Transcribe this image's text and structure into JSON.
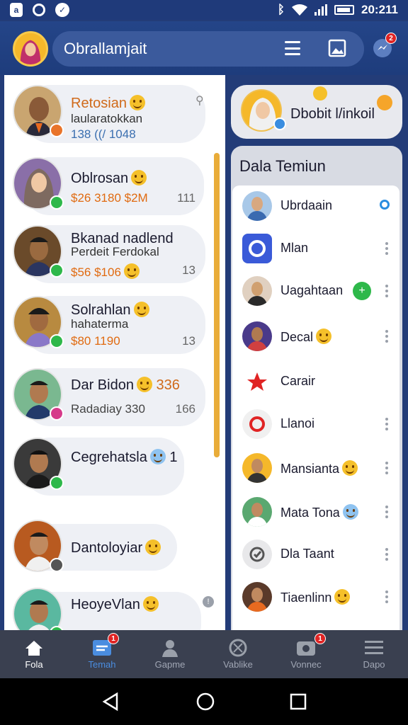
{
  "status_bar": {
    "time": "20:211",
    "icons": [
      "lock-icon",
      "ring-icon",
      "messenger-icon",
      "bluetooth-icon",
      "wifi-icon",
      "signal-icon",
      "battery-icon"
    ]
  },
  "header": {
    "title": "Obrallamjait",
    "menu_icon": "menu-icon",
    "gallery_icon": "gallery-icon",
    "gallery_badge": "",
    "messenger_icon": "messenger-icon",
    "messenger_badge": "2"
  },
  "chats": [
    {
      "name": "Retosian",
      "sub": "laularatokkan",
      "meta": "138 ((/ 1048",
      "count": "",
      "dot": "#e9742a"
    },
    {
      "name": "Oblrosan",
      "sub": "",
      "meta": "$26 3180 $2M",
      "count": "111",
      "dot": "#2eb84a"
    },
    {
      "name": "Bkanad nadlend",
      "sub": "Perdeit Ferdokal",
      "meta": "$56 $106",
      "count": "13",
      "dot": "#2eb84a"
    },
    {
      "name": "Solrahlan",
      "sub": "hahaterma",
      "meta": "$80 1190",
      "count": "13",
      "dot": "#2eb84a"
    },
    {
      "name": "Dar Bidon",
      "sub": "",
      "meta": "Radadiay 330",
      "count": "166",
      "name_extra": "336",
      "dot": "#d63a8a"
    },
    {
      "name": "Cegrehatsla",
      "sub": "",
      "meta": "",
      "count": "",
      "name_extra": "1",
      "dot": "#2eb84a"
    },
    {
      "name": "Dantoloyiar",
      "sub": "",
      "meta": "",
      "count": "",
      "dot": "#555"
    },
    {
      "name": "HeoyeVlan",
      "sub": "",
      "meta": "",
      "count": "",
      "dot": "#2eb84a"
    }
  ],
  "right_panel": {
    "profile_name": "Dbobit l/inkoil",
    "list_title": "Dala Temiun",
    "friends": [
      {
        "name": "Ubrdaain",
        "icon": "person"
      },
      {
        "name": "Mlan",
        "icon": "app"
      },
      {
        "name": "Uagahtaan",
        "icon": "person"
      },
      {
        "name": "Decal",
        "icon": "person"
      },
      {
        "name": "Carair",
        "icon": "star"
      },
      {
        "name": "Llanoi",
        "icon": "circle"
      },
      {
        "name": "Mansianta",
        "icon": "person"
      },
      {
        "name": "Mata Tona",
        "icon": "person"
      },
      {
        "name": "Dla Taant",
        "icon": "clock"
      },
      {
        "name": "Tiaenlinn",
        "icon": "person"
      }
    ]
  },
  "bottom_nav": [
    {
      "label": "Fola",
      "icon": "home-icon",
      "badge": ""
    },
    {
      "label": "Temah",
      "icon": "friends-icon",
      "badge": "1"
    },
    {
      "label": "Gapme",
      "icon": "user-icon",
      "badge": ""
    },
    {
      "label": "Vablike",
      "icon": "globe-icon",
      "badge": ""
    },
    {
      "label": "Vonnec",
      "icon": "camera-icon",
      "badge": "1"
    },
    {
      "label": "Dapo",
      "icon": "menu-icon",
      "badge": ""
    }
  ]
}
